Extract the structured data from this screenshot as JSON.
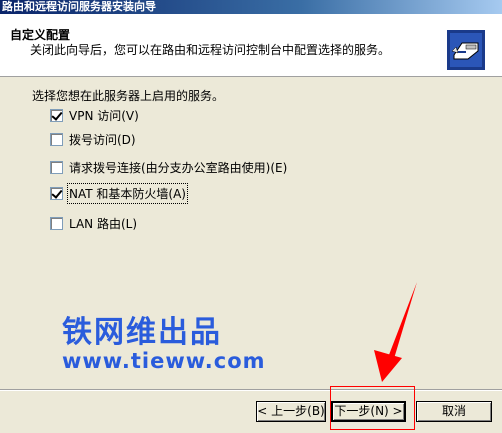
{
  "window": {
    "title": "路由和远程访问服务器安装向导"
  },
  "header": {
    "title": "自定义配置",
    "subtitle": "关闭此向导后，您可以在路由和远程访问控制台中配置选择的服务。",
    "icon": "network-server-icon"
  },
  "main": {
    "prompt": "选择您想在此服务器上启用的服务。",
    "options": [
      {
        "label": "VPN 访问(V)",
        "checked": true
      },
      {
        "label": "拨号访问(D)",
        "checked": false
      },
      {
        "label": "请求拨号连接(由分支办公室路由使用)(E)",
        "checked": false
      },
      {
        "label": "NAT 和基本防火墙(A)",
        "checked": true
      },
      {
        "label": "LAN 路由(L)",
        "checked": false
      }
    ]
  },
  "watermark": {
    "title": "铁网维出品",
    "url": "www.tieww.com"
  },
  "footer": {
    "back_label": "< 上一步(B)",
    "next_label": "下一步(N) >",
    "cancel_label": "取消"
  },
  "annotation": {
    "color": "#ff0000"
  }
}
